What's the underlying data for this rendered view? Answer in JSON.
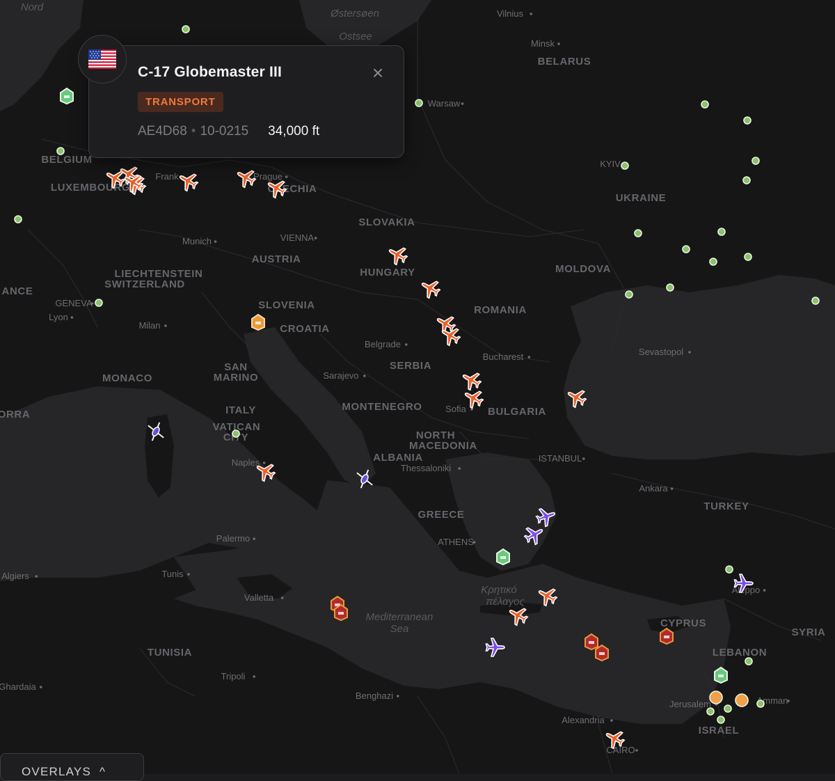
{
  "map": {
    "countries": [
      {
        "name": "BELARUS"
      },
      {
        "name": "BELGIUM"
      },
      {
        "name": "LUXEMBOURG"
      },
      {
        "name": "CZECHIA"
      },
      {
        "name": "UKRAINE"
      },
      {
        "name": "SLOVAKIA"
      },
      {
        "name": "AUSTRIA"
      },
      {
        "name": "HUNGARY"
      },
      {
        "name": "MOLDOVA"
      },
      {
        "name": "LIECHTENSTEIN"
      },
      {
        "name": "SWITZERLAND"
      },
      {
        "name": "SLOVENIA"
      },
      {
        "name": "ROMANIA"
      },
      {
        "name": "CROATIA"
      },
      {
        "name": "SERBIA"
      },
      {
        "name": "SAN"
      },
      {
        "name": "MARINO"
      },
      {
        "name": "MONACO"
      },
      {
        "name": "ITALY"
      },
      {
        "name": "VATICAN"
      },
      {
        "name": "CITY"
      },
      {
        "name": "MONTENEGRO"
      },
      {
        "name": "BULGARIA"
      },
      {
        "name": "NORTH"
      },
      {
        "name": "MACEDONIA"
      },
      {
        "name": "ALBANIA"
      },
      {
        "name": "GREECE"
      },
      {
        "name": "TURKEY"
      },
      {
        "name": "CYPRUS"
      },
      {
        "name": "SYRIA"
      },
      {
        "name": "LEBANON"
      },
      {
        "name": "ISRAEL"
      },
      {
        "name": "TUNISIA"
      },
      {
        "name": "ANCE"
      },
      {
        "name": "ORRA"
      }
    ],
    "cities": [
      {
        "name": "Vilnius"
      },
      {
        "name": "Minsk"
      },
      {
        "name": "Warsaw"
      },
      {
        "name": "Frank"
      },
      {
        "name": "Prague"
      },
      {
        "name": "KYIV"
      },
      {
        "name": "Munich"
      },
      {
        "name": "VIENNA"
      },
      {
        "name": "GENEVA"
      },
      {
        "name": "Lyon"
      },
      {
        "name": "Milan"
      },
      {
        "name": "Belgrade"
      },
      {
        "name": "Bucharest"
      },
      {
        "name": "Sevastopol"
      },
      {
        "name": "Sarajevo"
      },
      {
        "name": "Sofia"
      },
      {
        "name": "Thessaloniki"
      },
      {
        "name": "ISTANBUL"
      },
      {
        "name": "Ankara"
      },
      {
        "name": "ATHENS"
      },
      {
        "name": "Palermo"
      },
      {
        "name": "Tunis"
      },
      {
        "name": "Algiers"
      },
      {
        "name": "Valletta"
      },
      {
        "name": "Tripoli"
      },
      {
        "name": "Ghardaia"
      },
      {
        "name": "Benghazi"
      },
      {
        "name": "Alexandria"
      },
      {
        "name": "CAIRO"
      },
      {
        "name": "Aleppo"
      },
      {
        "name": "Jerusalem"
      },
      {
        "name": "Amman"
      },
      {
        "name": "Naples"
      }
    ],
    "seas": [
      {
        "name": "Nord"
      },
      {
        "name": "Østersøen"
      },
      {
        "name": "Ostsee"
      },
      {
        "name": "Mediterranean"
      },
      {
        "name": "Sea"
      },
      {
        "name": "Κρητικό"
      },
      {
        "name": "πέλαγος"
      }
    ]
  },
  "markers": {
    "colors": {
      "transport": "#e8612b",
      "purple": "#7b4ee0",
      "white": "#f4f4f6",
      "sensor": "#8cc06a",
      "ship_green": "#6ac87f",
      "ship_orange": "#e89a3a",
      "ship_red": "#b32a2a",
      "orange_dot": "#f0a04a"
    },
    "aircraft": [
      {
        "kind": "transport",
        "heading": 60
      },
      {
        "kind": "transport",
        "heading": 60
      },
      {
        "kind": "transport",
        "heading": 60
      },
      {
        "kind": "transport",
        "heading": 60
      },
      {
        "kind": "transport",
        "heading": 60
      },
      {
        "kind": "transport",
        "heading": 60
      },
      {
        "kind": "transport",
        "heading": 60
      },
      {
        "kind": "transport",
        "heading": 60
      },
      {
        "kind": "transport",
        "heading": 60
      },
      {
        "kind": "transport",
        "heading": 60
      },
      {
        "kind": "transport",
        "heading": 60
      },
      {
        "kind": "transport",
        "heading": 60
      },
      {
        "kind": "transport",
        "heading": 60
      },
      {
        "kind": "transport",
        "heading": 60
      },
      {
        "kind": "transport",
        "heading": 60
      },
      {
        "kind": "transport",
        "heading": 60
      },
      {
        "kind": "transport",
        "heading": 60
      },
      {
        "kind": "transport",
        "heading": 60
      },
      {
        "kind": "purple",
        "heading": 0
      },
      {
        "kind": "purple",
        "heading": 20
      },
      {
        "kind": "purple",
        "heading": 0
      },
      {
        "kind": "purple",
        "heading": 0
      },
      {
        "kind": "white",
        "heading": 0
      },
      {
        "kind": "white",
        "heading": 0
      }
    ]
  },
  "popup": {
    "flag": "us-flag",
    "title": "C-17 Globemaster III",
    "category": "TRANSPORT",
    "hex": "AE4D68",
    "separator": "•",
    "registration": "10-0215",
    "altitude": "34,000 ft",
    "close": "×"
  },
  "controls": {
    "overlays_label": "OVERLAYS",
    "overlays_chevron": "^"
  }
}
